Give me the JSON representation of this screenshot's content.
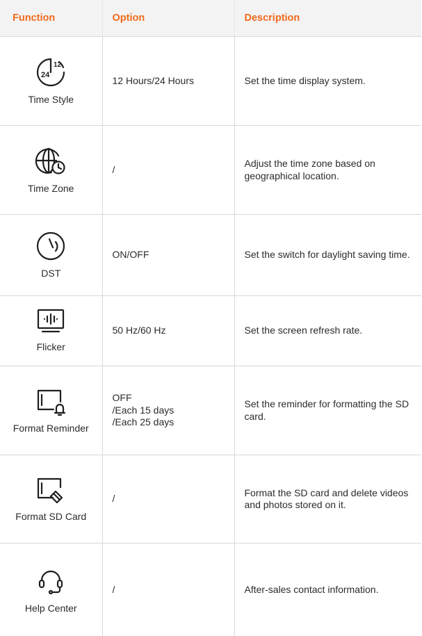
{
  "header": {
    "function": "Function",
    "option": "Option",
    "description": "Description"
  },
  "rows": [
    {
      "icon": "clock-24-12-icon",
      "function": "Time Style",
      "option": [
        "12 Hours/24 Hours"
      ],
      "description": "Set the time display system."
    },
    {
      "icon": "globe-clock-icon",
      "function": "Time Zone",
      "option": [
        "/"
      ],
      "description": "Adjust the time zone based on geographical location."
    },
    {
      "icon": "dst-clock-icon",
      "function": "DST",
      "option": [
        "ON/OFF"
      ],
      "description": "Set the switch for daylight saving time."
    },
    {
      "icon": "monitor-waveform-icon",
      "function": "Flicker",
      "option": [
        "50 Hz/60 Hz"
      ],
      "description": "Set the screen refresh rate."
    },
    {
      "icon": "sd-card-bell-icon",
      "function": "Format Reminder",
      "option": [
        "OFF",
        "/Each 15 days",
        "/Each 25 days"
      ],
      "description": "Set the reminder for formatting the SD card."
    },
    {
      "icon": "sd-card-eraser-icon",
      "function": "Format SD Card",
      "option": [
        "/"
      ],
      "description": "Format the SD card and delete videos and photos stored on it."
    },
    {
      "icon": "headset-icon",
      "function": "Help Center",
      "option": [
        "/"
      ],
      "description": "After-sales contact information."
    }
  ]
}
